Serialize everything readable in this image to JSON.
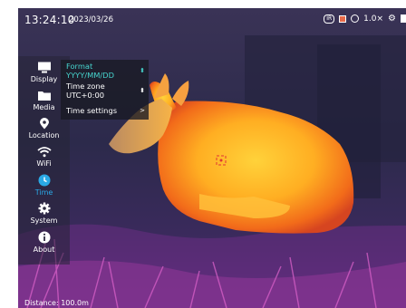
{
  "status": {
    "time": "13:24:10",
    "date": "2023/03/26",
    "ir_badge": "IR",
    "zoom": "1.0×"
  },
  "sidebar": {
    "items": [
      {
        "label": "Display",
        "icon": "monitor-icon",
        "active": false
      },
      {
        "label": "Media",
        "icon": "folder-icon",
        "active": false
      },
      {
        "label": "Location",
        "icon": "location-pin-icon",
        "active": false
      },
      {
        "label": "WiFi",
        "icon": "wifi-icon",
        "active": false
      },
      {
        "label": "Time",
        "icon": "clock-icon",
        "active": true
      },
      {
        "label": "System",
        "icon": "gear-icon",
        "active": false
      },
      {
        "label": "About",
        "icon": "info-icon",
        "active": false
      }
    ]
  },
  "submenu": {
    "format_label": "Format YYYY/MM/DD",
    "timezone_label": "Time zone UTC+0:00",
    "settings_label": "Time settings",
    "stepper_glyph": "⬍",
    "arrow_glyph": ">"
  },
  "footer": {
    "distance": "Distance:  100.0m"
  },
  "colors": {
    "accent": "#47d6cf",
    "active_icon": "#2aa9e6"
  }
}
